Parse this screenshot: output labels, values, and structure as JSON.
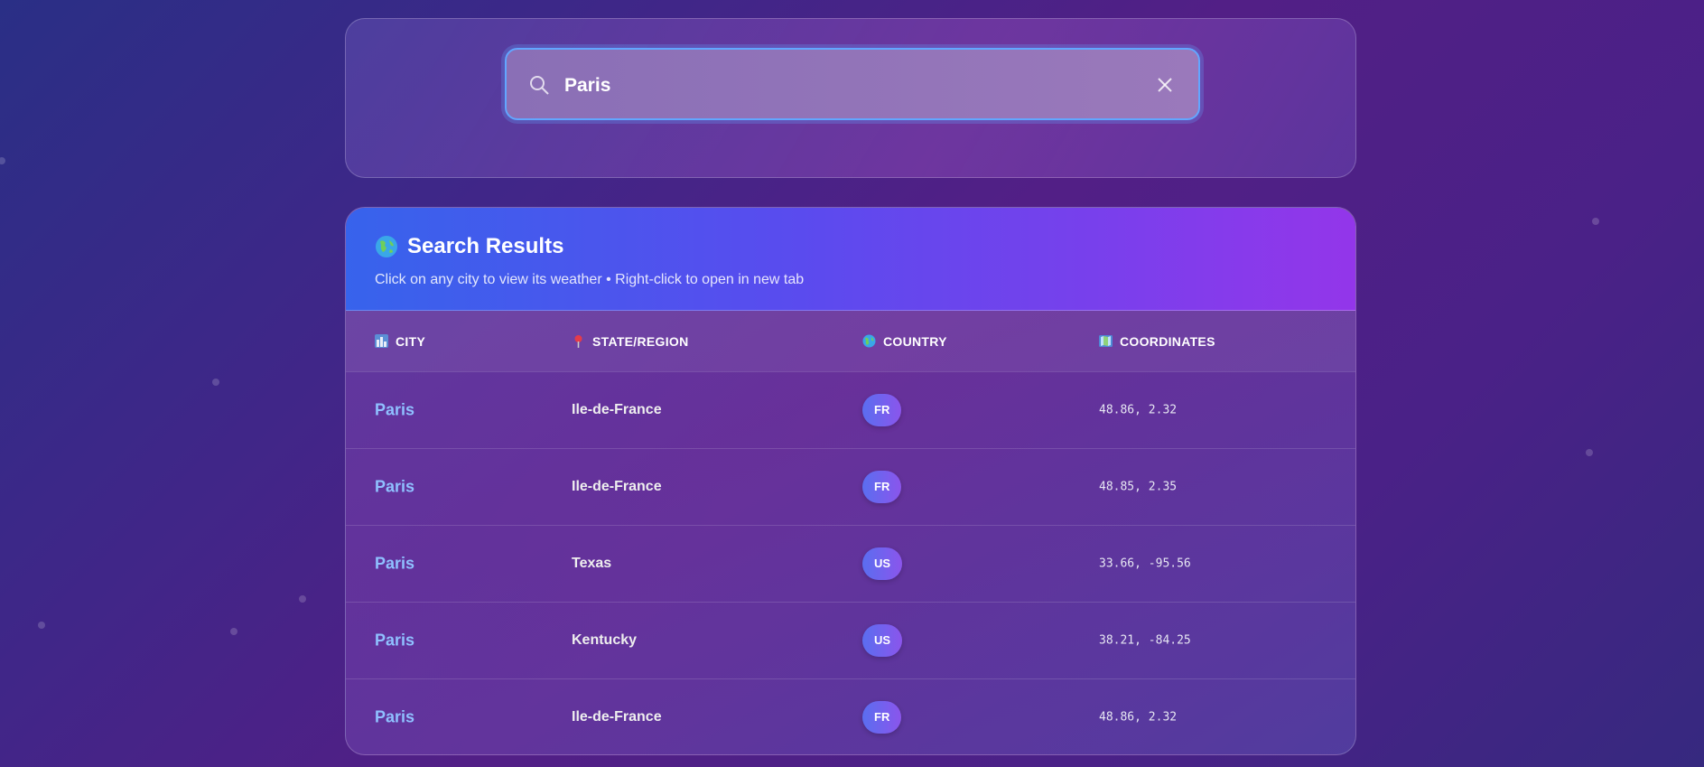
{
  "search": {
    "value": "Paris",
    "placeholder": "Search for a city..."
  },
  "results": {
    "title": "Search Results",
    "subtitle": "Click on any city to view its weather • Right-click to open in new tab",
    "columns": [
      {
        "label": "CITY",
        "icon": "cityscape-icon"
      },
      {
        "label": "STATE/REGION",
        "icon": "pin-icon"
      },
      {
        "label": "COUNTRY",
        "icon": "globe-icon"
      },
      {
        "label": "COORDINATES",
        "icon": "map-icon"
      }
    ],
    "rows": [
      {
        "city": "Paris",
        "region": "Ile-de-France",
        "country": "FR",
        "coords": "48.86, 2.32"
      },
      {
        "city": "Paris",
        "region": "Ile-de-France",
        "country": "FR",
        "coords": "48.85, 2.35"
      },
      {
        "city": "Paris",
        "region": "Texas",
        "country": "US",
        "coords": "33.66, -95.56"
      },
      {
        "city": "Paris",
        "region": "Kentucky",
        "country": "US",
        "coords": "38.21, -84.25"
      },
      {
        "city": "Paris",
        "region": "Ile-de-France",
        "country": "FR",
        "coords": "48.86, 2.32"
      }
    ]
  },
  "colors": {
    "accent": "#62a6ff",
    "city_link": "#8fc0ff",
    "header_gradient_start": "#3763ec",
    "header_gradient_end": "#9336ea"
  }
}
